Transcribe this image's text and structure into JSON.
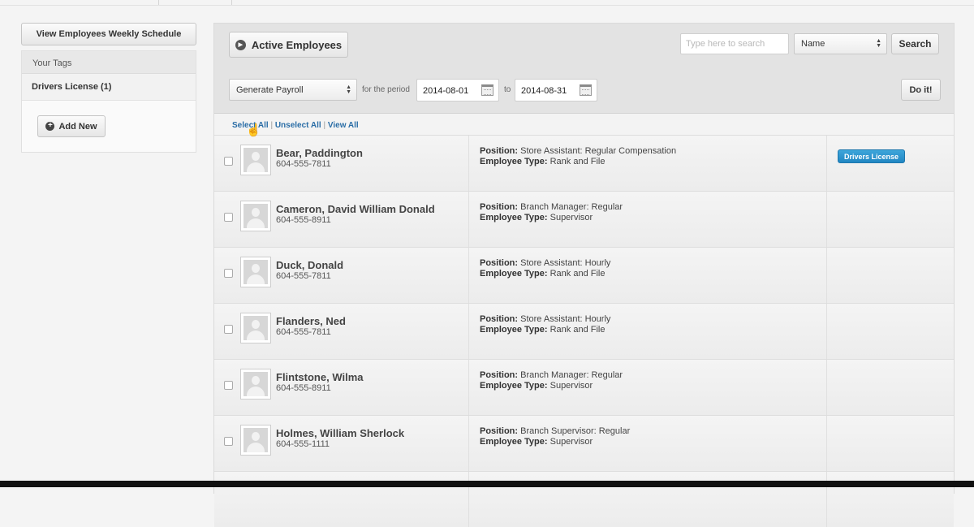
{
  "sidebar": {
    "weekly_schedule_label": "View Employees Weekly Schedule",
    "tags_header": "Your Tags",
    "tags": [
      {
        "label": "Drivers License (1)"
      }
    ],
    "add_new_label": "Add New"
  },
  "header": {
    "active_employees_label": "Active Employees",
    "search_placeholder": "Type here to search",
    "search_field_select": "Name",
    "search_button_label": "Search",
    "action_select": "Generate Payroll",
    "for_the_period_label": "for the period",
    "date_from": "2014-08-01",
    "to_label": "to",
    "date_to": "2014-08-31",
    "do_it_label": "Do it!"
  },
  "selection_links": {
    "select_all": "Select All",
    "unselect_all": "Unselect All",
    "view_all": "View All",
    "separator": "|"
  },
  "labels": {
    "position": "Position:",
    "employee_type": "Employee Type:"
  },
  "employees": [
    {
      "name": "Bear, Paddington",
      "phone": "604-555-7811",
      "position": "Store Assistant: Regular Compensation",
      "type": "Rank and File",
      "tag": "Drivers License"
    },
    {
      "name": "Cameron, David William Donald",
      "phone": "604-555-8911",
      "position": "Branch Manager: Regular",
      "type": "Supervisor",
      "tag": ""
    },
    {
      "name": "Duck, Donald",
      "phone": "604-555-7811",
      "position": "Store Assistant: Hourly",
      "type": "Rank and File",
      "tag": ""
    },
    {
      "name": "Flanders, Ned",
      "phone": "604-555-7811",
      "position": "Store Assistant: Hourly",
      "type": "Rank and File",
      "tag": ""
    },
    {
      "name": "Flintstone, Wilma",
      "phone": "604-555-8911",
      "position": "Branch Manager: Regular",
      "type": "Supervisor",
      "tag": ""
    },
    {
      "name": "Holmes, William Sherlock",
      "phone": "604-555-1111",
      "position": "Branch Supervisor: Regular",
      "type": "Supervisor",
      "tag": ""
    }
  ],
  "colors": {
    "tag_badge": "#2a95d1",
    "link": "#2a6da6"
  }
}
